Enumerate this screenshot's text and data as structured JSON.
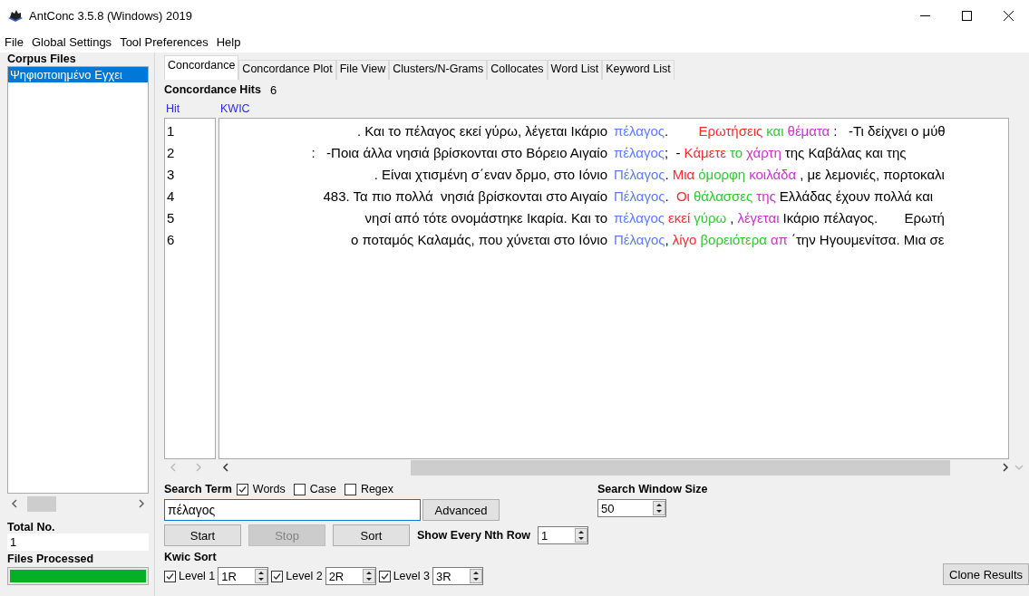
{
  "window": {
    "title": "AntConc 3.5.8 (Windows) 2019"
  },
  "menu": [
    "File",
    "Global Settings",
    "Tool Preferences",
    "Help"
  ],
  "corpus_files": {
    "label": "Corpus Files",
    "items": [
      {
        "name": "Ψηφιοποιημένο Εγχει",
        "selected": true
      }
    ],
    "total_label": "Total No.",
    "total": "1",
    "processed_label": "Files Processed",
    "progress": {
      "level": 1
    }
  },
  "tabs": [
    {
      "label": "Concordance",
      "selected": true
    },
    {
      "label": "Concordance Plot",
      "selected": false
    },
    {
      "label": "File View",
      "selected": false
    },
    {
      "label": "Clusters/N-Grams",
      "selected": false
    },
    {
      "label": "Collocates",
      "selected": false
    },
    {
      "label": "Word List",
      "selected": false
    },
    {
      "label": "Keyword List",
      "selected": false
    }
  ],
  "hits": {
    "label": "Concordance Hits",
    "count": "6"
  },
  "table": {
    "columns": [
      "Hit",
      "KWIC"
    ],
    "rows": [
      {
        "hit": "1",
        "left": ". Και το πέλαγος εκεί γύρω, λέγεται Ικάριο",
        "keyword": "πέλαγος",
        "right": [
          {
            "text": ".       "
          },
          {
            "text": "Ερωτήσεις",
            "color": "#ff2a2a"
          },
          {
            "text": "και",
            "color": "#2ecc2e"
          },
          {
            "text": "θέματα",
            "color": "#cc33cc"
          },
          {
            "text": ":   -Τι δείχνει ο μύθ"
          }
        ]
      },
      {
        "hit": "2",
        "left": ":   -Ποια άλλα νησιά βρίσκονται στο Βόρειο Αιγαίο",
        "keyword": "πέλαγος",
        "right": [
          {
            "text": ";  -"
          },
          {
            "text": "Κάμετε",
            "color": "#ff2a2a"
          },
          {
            "text": "το",
            "color": "#2ecc2e"
          },
          {
            "text": "χάρτη",
            "color": "#cc33cc"
          },
          {
            "text": "της Καβάλας και της"
          }
        ]
      },
      {
        "hit": "3",
        "left": ". Είναι χτισμένη σ΄εναν δρμο, στο Ιόνιο",
        "keyword": "Πέλαγος",
        "right": [
          {
            "text": "."
          },
          {
            "text": "Μια",
            "color": "#ff2a2a"
          },
          {
            "text": "όμορφη",
            "color": "#2ecc2e"
          },
          {
            "text": "κοιλάδα",
            "color": "#cc33cc"
          },
          {
            "text": ", με λεμονιές, πορτοκαλι"
          }
        ]
      },
      {
        "hit": "4",
        "left": "483. Τα πιο πολλά  νησιά βρίσκονται στο Αιγαίο",
        "keyword": "Πέλαγος",
        "right": [
          {
            "text": ". "
          },
          {
            "text": "Οι",
            "color": "#ff2a2a"
          },
          {
            "text": "θάλασσες",
            "color": "#2ecc2e"
          },
          {
            "text": "της",
            "color": "#cc33cc"
          },
          {
            "text": "Ελλάδας έχουν πολλά και"
          }
        ]
      },
      {
        "hit": "5",
        "left": "νησί από τότε ονομάστηκε Ικαρία. Και το",
        "keyword": "πέλαγος",
        "right": [
          {
            "text": "εκεί",
            "color": "#ff2a2a"
          },
          {
            "text": "γύρω",
            "color": "#2ecc2e"
          },
          {
            "text": ","
          },
          {
            "text": "λέγεται",
            "color": "#cc33cc"
          },
          {
            "text": "Ικάριο πέλαγος.       Ερωτή"
          }
        ]
      },
      {
        "hit": "6",
        "left": "ο ποταμός Καλαμάς, που χύνεται στο Ιόνιο",
        "keyword": "Πέλαγος",
        "right": [
          {
            "text": ","
          },
          {
            "text": "λίγο",
            "color": "#ff2a2a"
          },
          {
            "text": "βορειότερα",
            "color": "#2ecc2e"
          },
          {
            "text": "απ",
            "color": "#cc33cc"
          },
          {
            "text": "΄την Ηγουμενίτσα. Μια σε"
          }
        ]
      }
    ]
  },
  "search": {
    "label": "Search Term",
    "options": [
      {
        "label": "Words",
        "checked": true
      },
      {
        "label": "Case",
        "checked": false
      },
      {
        "label": "Regex",
        "checked": false
      }
    ],
    "term": "πέλαγος",
    "advanced": "Advanced",
    "buttons": [
      {
        "label": "Start",
        "disabled": false
      },
      {
        "label": "Stop",
        "disabled": true
      },
      {
        "label": "Sort",
        "disabled": false
      }
    ]
  },
  "window_size": {
    "label": "Search Window Size",
    "value": "50"
  },
  "nth_row": {
    "label": "Show Every Nth Row",
    "value": "1"
  },
  "kwic_sort": {
    "label": "Kwic Sort",
    "levels": [
      {
        "label": "Level 1",
        "checked": true,
        "value": "1R"
      },
      {
        "label": "Level 2",
        "checked": true,
        "value": "2R"
      },
      {
        "label": "Level 3",
        "checked": true,
        "value": "3R"
      }
    ]
  },
  "clone_button": "Clone Results"
}
